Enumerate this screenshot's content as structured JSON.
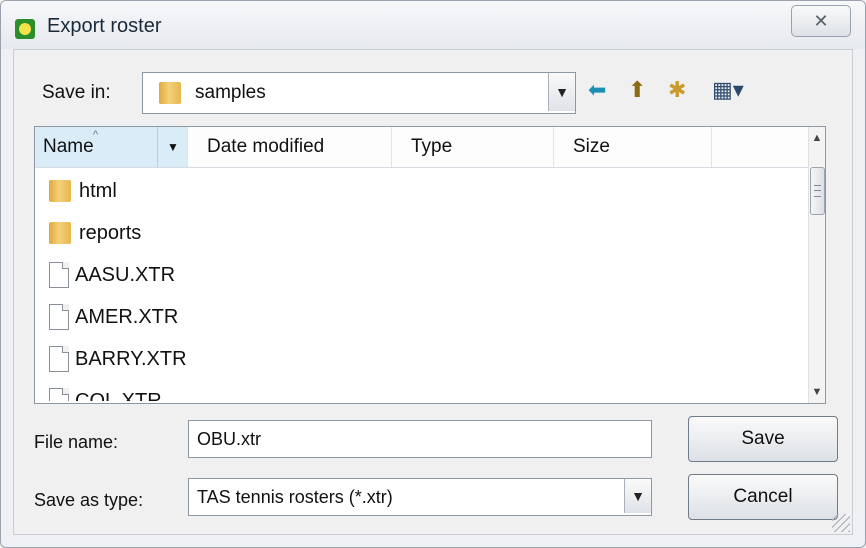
{
  "window": {
    "title": "Export roster",
    "close_glyph": "✕"
  },
  "toolbar": {
    "save_in_label": "Save in:",
    "save_in_value": "samples",
    "back_icon": "back-arrow-icon",
    "up_icon": "up-folder-icon",
    "new_folder_icon": "new-folder-icon",
    "views_icon": "views-menu-icon"
  },
  "filelist": {
    "columns": [
      "Name",
      "Date modified",
      "Type",
      "Size"
    ],
    "items": [
      {
        "name": "html",
        "kind": "folder"
      },
      {
        "name": "reports",
        "kind": "folder"
      },
      {
        "name": "AASU.XTR",
        "kind": "file"
      },
      {
        "name": "AMER.XTR",
        "kind": "file"
      },
      {
        "name": "BARRY.XTR",
        "kind": "file"
      },
      {
        "name": "COL.XTR",
        "kind": "file"
      }
    ]
  },
  "form": {
    "file_name_label": "File name:",
    "file_name_value": "OBU.xtr",
    "save_as_type_label": "Save as type:",
    "save_as_type_value": "TAS tennis rosters (*.xtr)",
    "save_button": "Save",
    "cancel_button": "Cancel"
  },
  "colors": {
    "selected_header": "#d9ecf8",
    "folder": "#e6b64f",
    "app_icon": "#2c8f2c"
  }
}
